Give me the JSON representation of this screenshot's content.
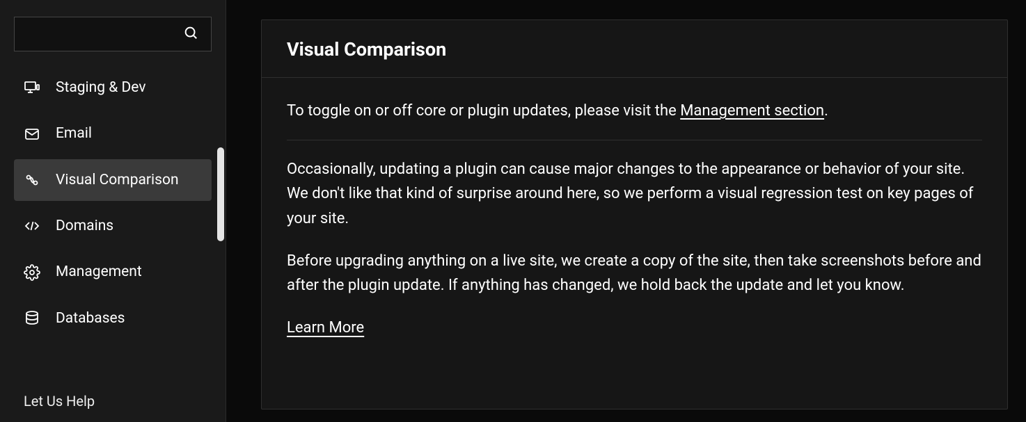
{
  "sidebar": {
    "search": {
      "placeholder": ""
    },
    "items": [
      {
        "label": "Staging & Dev",
        "icon": "monitor-icon",
        "active": false
      },
      {
        "label": "Email",
        "icon": "mail-icon",
        "active": false
      },
      {
        "label": "Visual Comparison",
        "icon": "compare-icon",
        "active": true
      },
      {
        "label": "Domains",
        "icon": "code-icon",
        "active": false
      },
      {
        "label": "Management",
        "icon": "gear-icon",
        "active": false
      },
      {
        "label": "Databases",
        "icon": "database-icon",
        "active": false
      }
    ],
    "footer": "Let Us Help"
  },
  "main": {
    "title": "Visual Comparison",
    "intro_prefix": "To toggle on or off core or plugin updates, please visit the ",
    "intro_link": "Management section",
    "intro_suffix": ".",
    "para1": "Occasionally, updating a plugin can cause major changes to the appearance or behavior of your site. We don't like that kind of surprise around here, so we perform a visual regression test on key pages of your site.",
    "para2": "Before upgrading anything on a live site, we create a copy of the site, then take screenshots before and after the plugin update. If anything has changed, we hold back the update and let you know.",
    "learn_more": "Learn More"
  }
}
